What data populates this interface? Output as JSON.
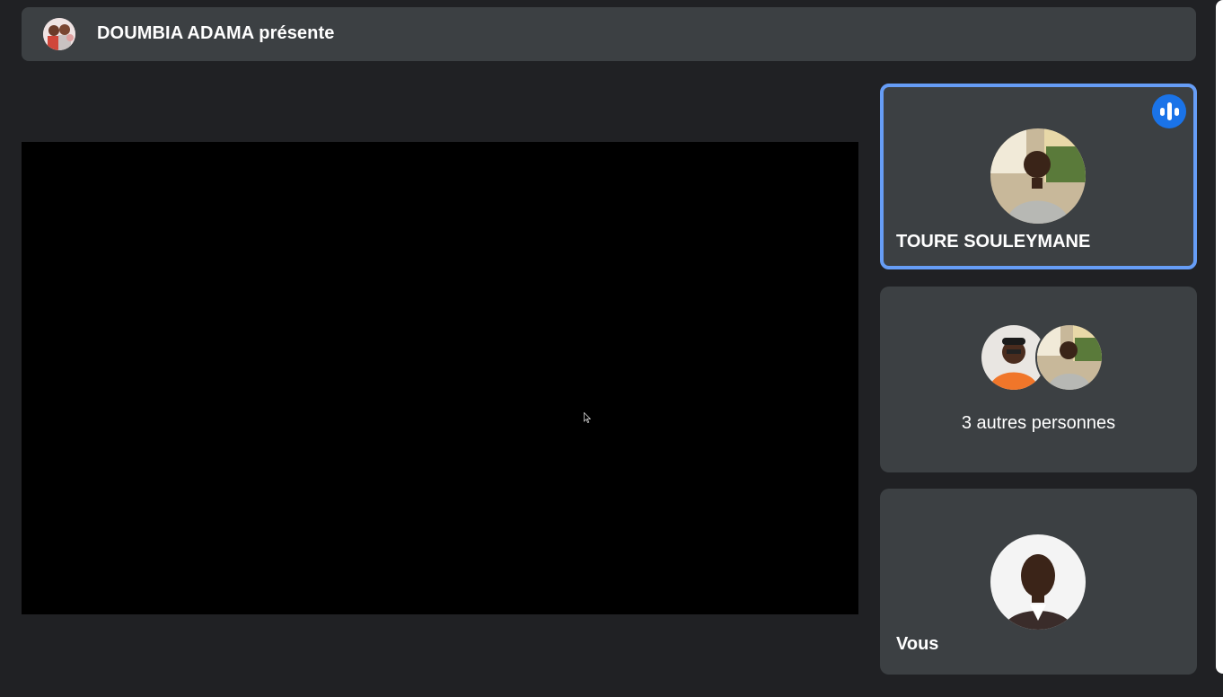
{
  "presenter": {
    "label": "DOUMBIA ADAMA présente"
  },
  "participants": {
    "active_speaker": {
      "name": "TOURE SOULEYMANE",
      "speaking_icon": "audio-level-icon"
    },
    "others": {
      "label": "3 autres personnes"
    },
    "self": {
      "label": "Vous"
    }
  },
  "colors": {
    "background": "#202124",
    "tile": "#3c4043",
    "active_border": "#669df6",
    "speaking_badge": "#1a73e8"
  }
}
